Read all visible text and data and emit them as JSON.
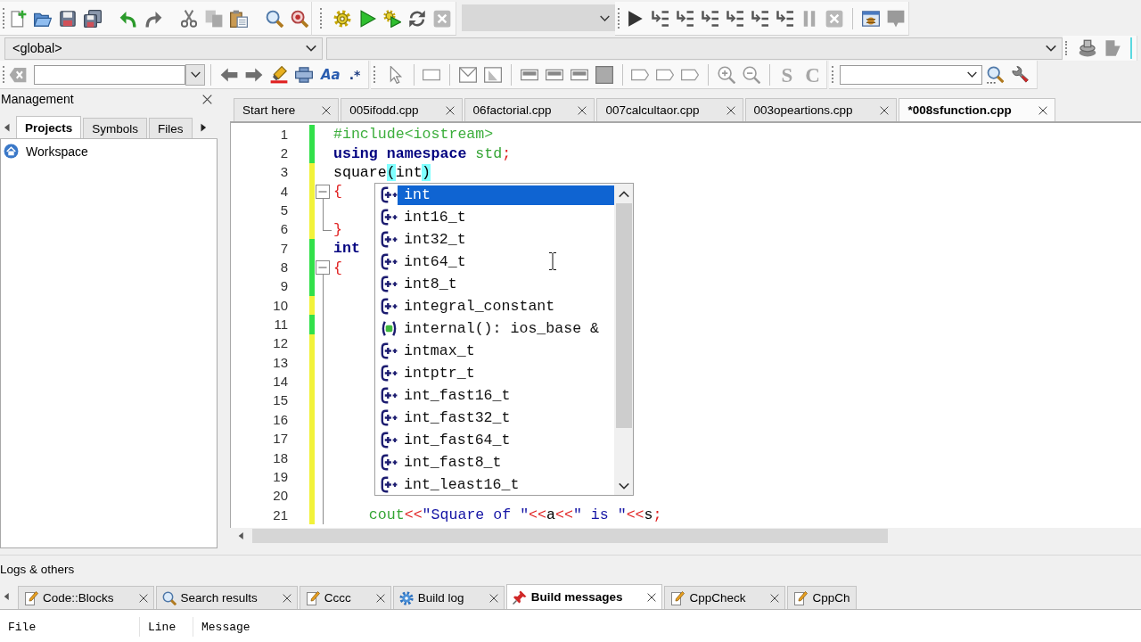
{
  "toolbar": {
    "scope": "<global>",
    "search_toggles": [
      "Aa",
      ".*"
    ],
    "letter_buttons": [
      "S",
      "C"
    ]
  },
  "management": {
    "title": "Management",
    "tabs": [
      {
        "label": "Projects",
        "selected": true
      },
      {
        "label": "Symbols",
        "selected": false
      },
      {
        "label": "Files",
        "selected": false
      }
    ],
    "tree": [
      {
        "label": "Workspace"
      }
    ]
  },
  "editor": {
    "tabs": [
      {
        "label": "Start here",
        "selected": false
      },
      {
        "label": "005ifodd.cpp",
        "selected": false
      },
      {
        "label": "06factorial.cpp",
        "selected": false
      },
      {
        "label": "007calcultaor.cpp",
        "selected": false
      },
      {
        "label": "003opeartions.cpp",
        "selected": false
      },
      {
        "label": "*008sfunction.cpp",
        "selected": true
      }
    ],
    "lines": [
      {
        "number": "1",
        "kind": "plain",
        "unsaved": false,
        "tokens": [
          {
            "text": "#include<iostream>",
            "kind": "preprocessor"
          }
        ]
      },
      {
        "number": "2",
        "kind": "plain",
        "unsaved": false,
        "tokens": [
          {
            "text": "using",
            "kind": "keyword"
          },
          {
            "text": " namespace",
            "kind": "keyword"
          },
          {
            "text": " std",
            "kind": "user_keyword"
          },
          {
            "text": ";",
            "kind": "operator"
          }
        ]
      },
      {
        "number": "3",
        "kind": "plain",
        "unsaved": true,
        "tokens": [
          {
            "text": "square",
            "kind": "plain"
          },
          {
            "text": "(",
            "kind": "brace_match"
          },
          {
            "text": "int",
            "kind": "plain",
            "caret_after": true
          },
          {
            "text": ")",
            "kind": "brace_match"
          }
        ]
      },
      {
        "number": "4",
        "kind": "fold_start",
        "unsaved": true,
        "tokens": [
          {
            "text": "{",
            "kind": "operator"
          }
        ]
      },
      {
        "number": "5",
        "kind": "fold_body",
        "unsaved": true
      },
      {
        "number": "6",
        "kind": "fold_end",
        "unsaved": true,
        "tokens": [
          {
            "text": "}",
            "kind": "operator"
          }
        ]
      },
      {
        "number": "7",
        "kind": "plain",
        "unsaved": false,
        "tokens": [
          {
            "text": "int",
            "kind": "keyword"
          }
        ]
      },
      {
        "number": "8",
        "kind": "fold_start",
        "unsaved": false,
        "tokens": [
          {
            "text": "{",
            "kind": "operator"
          }
        ]
      },
      {
        "number": "9",
        "kind": "fold_body",
        "unsaved": false
      },
      {
        "number": "10",
        "kind": "fold_body",
        "unsaved": true
      },
      {
        "number": "11",
        "kind": "fold_body",
        "unsaved": false
      },
      {
        "number": "12",
        "kind": "fold_body",
        "unsaved": true
      },
      {
        "number": "13",
        "kind": "fold_body",
        "unsaved": true
      },
      {
        "number": "14",
        "kind": "fold_body",
        "unsaved": true
      },
      {
        "number": "15",
        "kind": "fold_body",
        "unsaved": true
      },
      {
        "number": "16",
        "kind": "fold_body",
        "unsaved": true
      },
      {
        "number": "17",
        "kind": "fold_body",
        "unsaved": true
      },
      {
        "number": "18",
        "kind": "fold_body",
        "unsaved": true
      },
      {
        "number": "19",
        "kind": "fold_body",
        "unsaved": true
      },
      {
        "number": "20",
        "kind": "fold_body",
        "unsaved": true
      },
      {
        "number": "21",
        "kind": "fold_body",
        "unsaved": true,
        "indented": true,
        "tokens": [
          {
            "text": "cout",
            "kind": "user_keyword"
          },
          {
            "text": "<<",
            "kind": "operator"
          },
          {
            "text": "\"Square of \"",
            "kind": "string"
          },
          {
            "text": "<<",
            "kind": "operator"
          },
          {
            "text": "a",
            "kind": "plain"
          },
          {
            "text": "<<",
            "kind": "operator"
          },
          {
            "text": "\" is \"",
            "kind": "string"
          },
          {
            "text": "<<",
            "kind": "operator"
          },
          {
            "text": "s",
            "kind": "plain"
          },
          {
            "text": ";",
            "kind": "operator"
          }
        ]
      }
    ]
  },
  "autocomplete": {
    "items": [
      {
        "label": "int",
        "kind": "type",
        "selected": true
      },
      {
        "label": "int16_t",
        "kind": "type",
        "selected": false
      },
      {
        "label": "int32_t",
        "kind": "type",
        "selected": false
      },
      {
        "label": "int64_t",
        "kind": "type",
        "selected": false
      },
      {
        "label": "int8_t",
        "kind": "type",
        "selected": false
      },
      {
        "label": "integral_constant",
        "kind": "type",
        "selected": false
      },
      {
        "label": "internal(): ios_base &",
        "kind": "function",
        "selected": false
      },
      {
        "label": "intmax_t",
        "kind": "type",
        "selected": false
      },
      {
        "label": "intptr_t",
        "kind": "type",
        "selected": false
      },
      {
        "label": "int_fast16_t",
        "kind": "type",
        "selected": false
      },
      {
        "label": "int_fast32_t",
        "kind": "type",
        "selected": false
      },
      {
        "label": "int_fast64_t",
        "kind": "type",
        "selected": false
      },
      {
        "label": "int_fast8_t",
        "kind": "type",
        "selected": false
      },
      {
        "label": "int_least16_t",
        "kind": "type",
        "selected": false
      }
    ]
  },
  "logs": {
    "title": "Logs & others",
    "tabs": [
      {
        "label": "Code::Blocks",
        "kind": "text_log",
        "selected": false,
        "closable": true
      },
      {
        "label": "Search results",
        "kind": "search",
        "selected": false,
        "closable": true
      },
      {
        "label": "Cccc",
        "kind": "text_log",
        "selected": false,
        "closable": true
      },
      {
        "label": "Build log",
        "kind": "build_log",
        "selected": false,
        "closable": true
      },
      {
        "label": "Build messages",
        "kind": "messages",
        "selected": true,
        "closable": true
      },
      {
        "label": "CppCheck",
        "kind": "text_log",
        "selected": false,
        "closable": true
      },
      {
        "label": "CppCh",
        "kind": "text_log",
        "selected": false,
        "closable": false
      }
    ],
    "columns": [
      "File",
      "Line",
      "Message"
    ]
  }
}
